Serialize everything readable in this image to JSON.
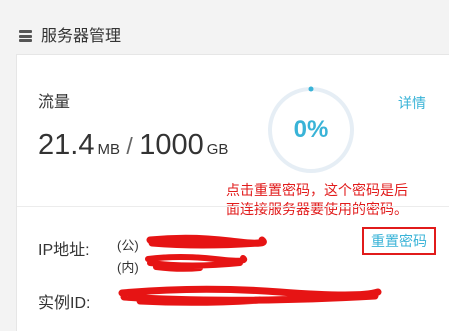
{
  "header": {
    "title": "服务器管理",
    "icon": "server-icon"
  },
  "traffic": {
    "label": "流量",
    "used": "21.4",
    "used_unit": "MB",
    "separator": "/",
    "total": "1000",
    "total_unit": "GB",
    "percent_label": "0%",
    "percent": 0,
    "details_label": "详情"
  },
  "annotation": {
    "line1": "点击重置密码，这个密码是后",
    "line2": "面连接服务器要使用的密码。",
    "color": "#e11b1b"
  },
  "server": {
    "ip_label": "IP地址:",
    "public_tag": "(公)",
    "private_tag": "(内)",
    "reset_password_label": "重置密码",
    "instance_id_label": "实例ID:"
  },
  "colors": {
    "accent": "#39b3d7",
    "annotation": "#e11b1b",
    "gauge_track": "#e6eef5"
  }
}
